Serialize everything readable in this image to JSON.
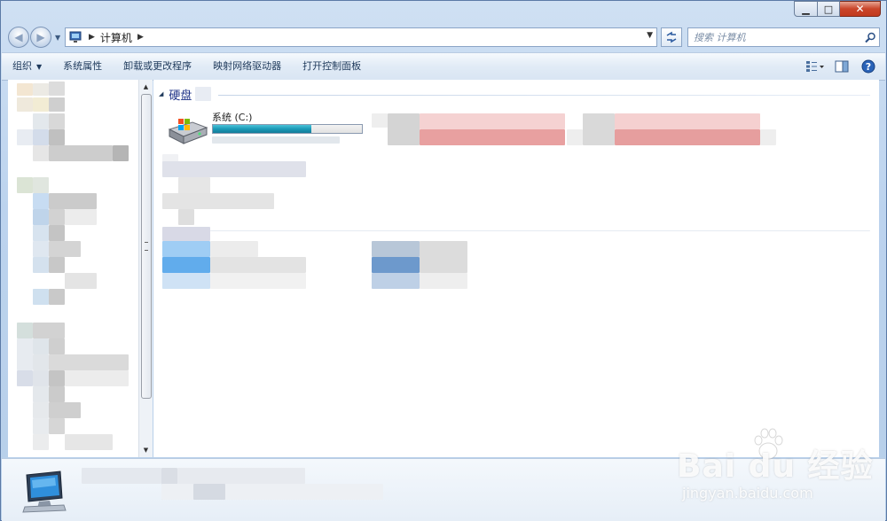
{
  "window": {
    "buttons": {
      "minimize": "▁",
      "maximize": "□",
      "close": "✕"
    }
  },
  "navigation": {
    "back_icon": "back-arrow-icon",
    "forward_icon": "forward-arrow-icon"
  },
  "address": {
    "location": "计算机",
    "separator": "▶"
  },
  "search": {
    "placeholder": "搜索 计算机"
  },
  "toolbar": {
    "organize_label": "组织",
    "items": [
      "系统属性",
      "卸载或更改程序",
      "映射网络驱动器",
      "打开控制面板"
    ],
    "caret": "▼"
  },
  "content": {
    "group_title": "硬盘",
    "drive": {
      "name": "系统 (C:)",
      "usage_fraction": 0.66
    }
  },
  "watermark": {
    "brand": "Bai du 经验",
    "url": "jingyan.baidu.com"
  },
  "colors": {
    "accent": "#1e3287",
    "bar_fill": "#1b9ab8",
    "window_frame": "#bcd3ee"
  }
}
